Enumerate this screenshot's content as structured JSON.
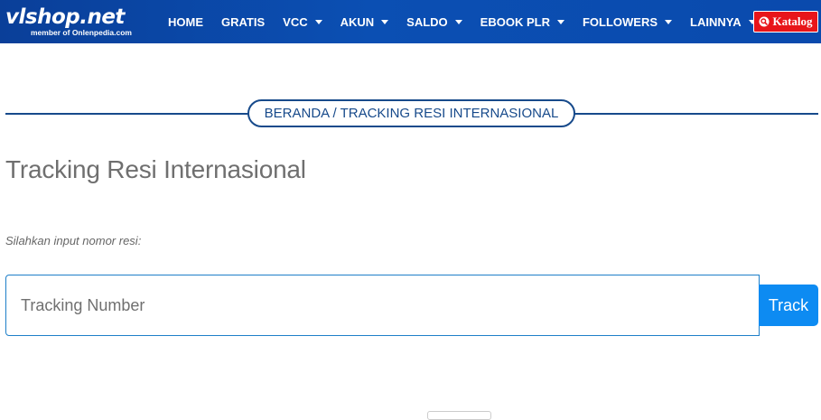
{
  "header": {
    "logo_text": "vlshop.net",
    "logo_tagline": "member of Onlenpedia.com",
    "nav": [
      {
        "label": "HOME",
        "dropdown": false
      },
      {
        "label": "GRATIS",
        "dropdown": false
      },
      {
        "label": "VCC",
        "dropdown": true
      },
      {
        "label": "AKUN",
        "dropdown": true
      },
      {
        "label": "SALDO",
        "dropdown": true
      },
      {
        "label": "EBOOK PLR",
        "dropdown": true
      },
      {
        "label": "FOLLOWERS",
        "dropdown": true
      },
      {
        "label": "LAINNYA",
        "dropdown": true
      }
    ],
    "katalog_label": "Katalog",
    "colors": {
      "header_bg": "#0b4fb3",
      "katalog_bg": "#e8151a"
    }
  },
  "breadcrumb": "BERANDA / TRACKING RESI INTERNASIONAL",
  "page_title": "Tracking Resi Internasional",
  "hint": "Silahkan input nomor resi:",
  "form": {
    "input_placeholder": "Tracking Number",
    "input_value": "",
    "button_label": "Track",
    "button_color": "#0d8bf2"
  }
}
